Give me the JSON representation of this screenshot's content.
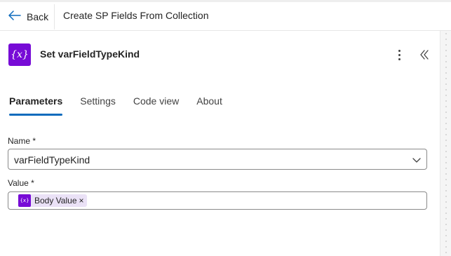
{
  "topbar": {
    "back_label": "Back",
    "flow_title": "Create SP Fields From Collection"
  },
  "panel": {
    "action_icon_text": "{x}",
    "action_title": "Set varFieldTypeKind",
    "tabs": [
      {
        "label": "Parameters",
        "active": true
      },
      {
        "label": "Settings",
        "active": false
      },
      {
        "label": "Code view",
        "active": false
      },
      {
        "label": "About",
        "active": false
      }
    ]
  },
  "form": {
    "name_label": "Name *",
    "name_value": "varFieldTypeKind",
    "value_label": "Value *",
    "value_token": {
      "icon_text": "{x}",
      "label": "Body Value",
      "remove_glyph": "×"
    }
  },
  "colors": {
    "accent": "#0f6cbd",
    "variable_purple": "#770bd6",
    "token_bg": "#eae1f6"
  },
  "icons": {
    "back": "arrow-left-icon",
    "action": "variable-icon",
    "more": "more-vertical-icon",
    "collapse": "double-chevron-left-icon",
    "dropdown": "chevron-down-icon"
  }
}
